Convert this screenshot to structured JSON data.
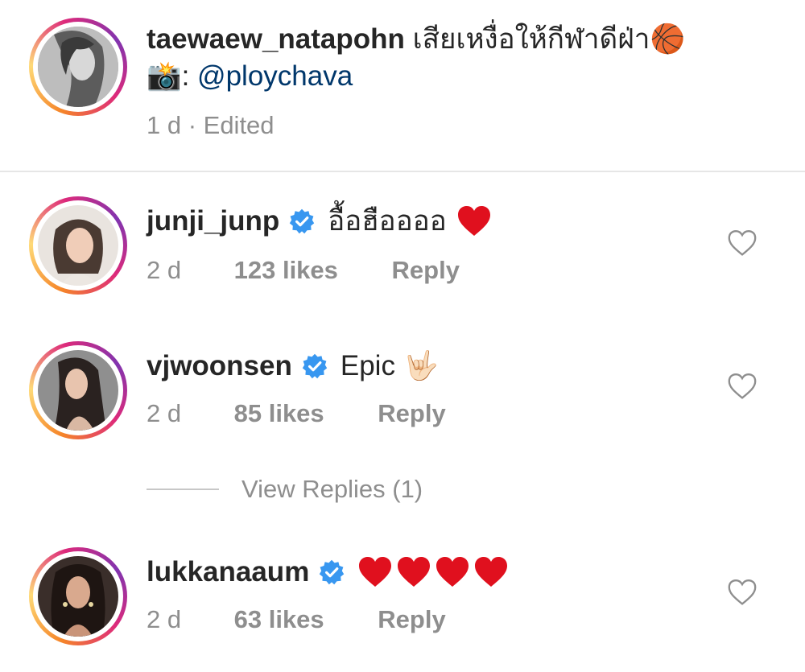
{
  "caption": {
    "username": "taewaew_natapohn",
    "text": " เสียเหงื่อให้กีฬาดีฝ่า",
    "emoji_ball": "🏀",
    "emoji_camera": "📸",
    "colon": ": ",
    "mention": "@ploychava",
    "meta": "1 d · Edited"
  },
  "comments": [
    {
      "username": "junji_junp",
      "verified": true,
      "text": "อื้อฮืออออ",
      "emoji": "heart",
      "time": "2 d",
      "likes": "123 likes",
      "reply": "Reply"
    },
    {
      "username": "vjwoonsen",
      "verified": true,
      "text": "Epic",
      "emoji": "🤟🏻",
      "time": "2 d",
      "likes": "85 likes",
      "reply": "Reply"
    },
    {
      "username": "lukkanaaum",
      "verified": true,
      "text": "",
      "emoji": "heart x4",
      "time": "2 d",
      "likes": "63 likes",
      "reply": "Reply"
    }
  ],
  "view_replies": "View Replies (1)",
  "colors": {
    "text": "#262626",
    "muted": "#8e8e8e",
    "mention": "#00376b",
    "verified": "#3897f0",
    "heart": "#e0101e"
  },
  "icons": {
    "verified": "verified-badge-icon",
    "like": "heart-outline-icon"
  }
}
